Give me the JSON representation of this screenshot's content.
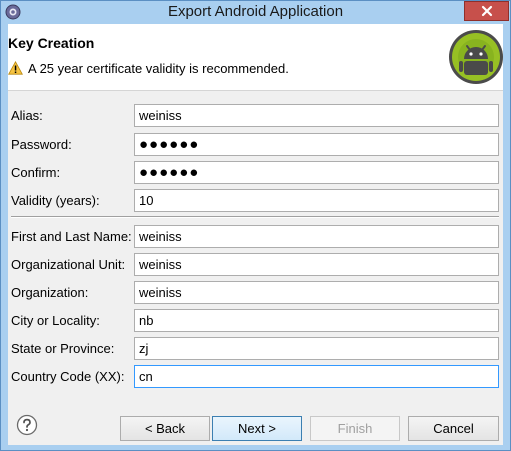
{
  "window": {
    "title": "Export Android Application"
  },
  "banner": {
    "title": "Key Creation",
    "warning": "A 25 year certificate validity is recommended."
  },
  "key_fields": [
    {
      "label": "Alias:",
      "value": "weiniss"
    },
    {
      "label": "Password:",
      "value": "●●●●●●"
    },
    {
      "label": "Confirm:",
      "value": "●●●●●●"
    },
    {
      "label": "Validity (years):",
      "value": "10"
    }
  ],
  "dn_fields": [
    {
      "label": "First and Last Name:",
      "value": "weiniss"
    },
    {
      "label": "Organizational Unit:",
      "value": "weiniss"
    },
    {
      "label": "Organization:",
      "value": "weiniss"
    },
    {
      "label": "City or Locality:",
      "value": "nb"
    },
    {
      "label": "State or Province:",
      "value": "zj"
    },
    {
      "label": "Country Code (XX):",
      "value": "cn"
    }
  ],
  "buttons": {
    "back": "< Back",
    "next": "Next >",
    "finish": "Finish",
    "cancel": "Cancel"
  },
  "colors": {
    "title_bar": "#a9cff0",
    "close_button": "#c7504b",
    "android_green": "#97c024",
    "focus_border": "#3399ff"
  }
}
